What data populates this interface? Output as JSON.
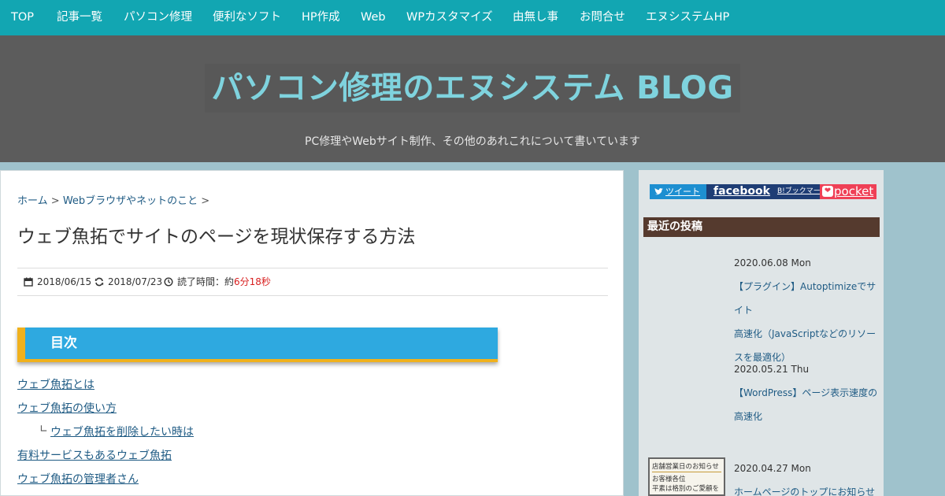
{
  "nav": [
    "TOP",
    "記事一覧",
    "パソコン修理",
    "便利なソフト",
    "HP作成",
    "Web",
    "WPカスタマイズ",
    "由無し事",
    "お問合せ",
    "エヌシステムHP"
  ],
  "header": {
    "site_title": "パソコン修理のエヌシステム BLOG",
    "tagline": "PC修理やWebサイト制作、その他のあれこれについて書いています"
  },
  "breadcrumb": {
    "home": "ホーム",
    "sep": ">",
    "category": "Webブラウザやネットのこと",
    "trail": ">"
  },
  "post": {
    "title": "ウェブ魚拓でサイトのページを現状保存する方法",
    "published": "2018/06/15",
    "updated": "2018/07/23",
    "read_prefix": "読了時間：約",
    "read_time": "6分18秒"
  },
  "toc": {
    "heading": "目次",
    "sub_mark": "∟",
    "items": [
      "ウェブ魚拓とは",
      "ウェブ魚拓の使い方",
      "ウェブ魚拓を削除したい時は",
      "有料サービスもあるウェブ魚拓",
      "ウェブ魚拓の管理者さん"
    ]
  },
  "share": {
    "tweet": "ツイート",
    "facebook": "facebook",
    "hatena": "B!ブックマーク",
    "pocket": "pocket"
  },
  "sidebar": {
    "recent_heading": "最近の投稿",
    "posts": [
      {
        "date": "2020.06.08 Mon",
        "title_lines": [
          "【プラグイン】Autoptimizeでサイト",
          "高速化（JavaScriptなどのリソー",
          "スを最適化）"
        ]
      },
      {
        "date": "2020.05.21 Thu",
        "title_lines": [
          "【WordPress】ページ表示速度の",
          "高速化"
        ]
      },
      {
        "date": "2020.04.27 Mon",
        "title_lines": [
          "ホームページのトップにお知らせ"
        ]
      }
    ],
    "thumb": {
      "line1": "店舗営業日のお知らせ",
      "line2": "お客様各位",
      "line3": "平素は格別のご愛顧を"
    }
  },
  "colors": {
    "nav_bg": "#12a6b2",
    "hero_bg": "#5c5c5c",
    "title": "#7fd3de",
    "link": "#1f5b84",
    "toc_bg": "#2ea9e0",
    "toc_accent": "#f0b11d",
    "widget_head": "#553a2e",
    "accent_red": "#d81e1e"
  }
}
